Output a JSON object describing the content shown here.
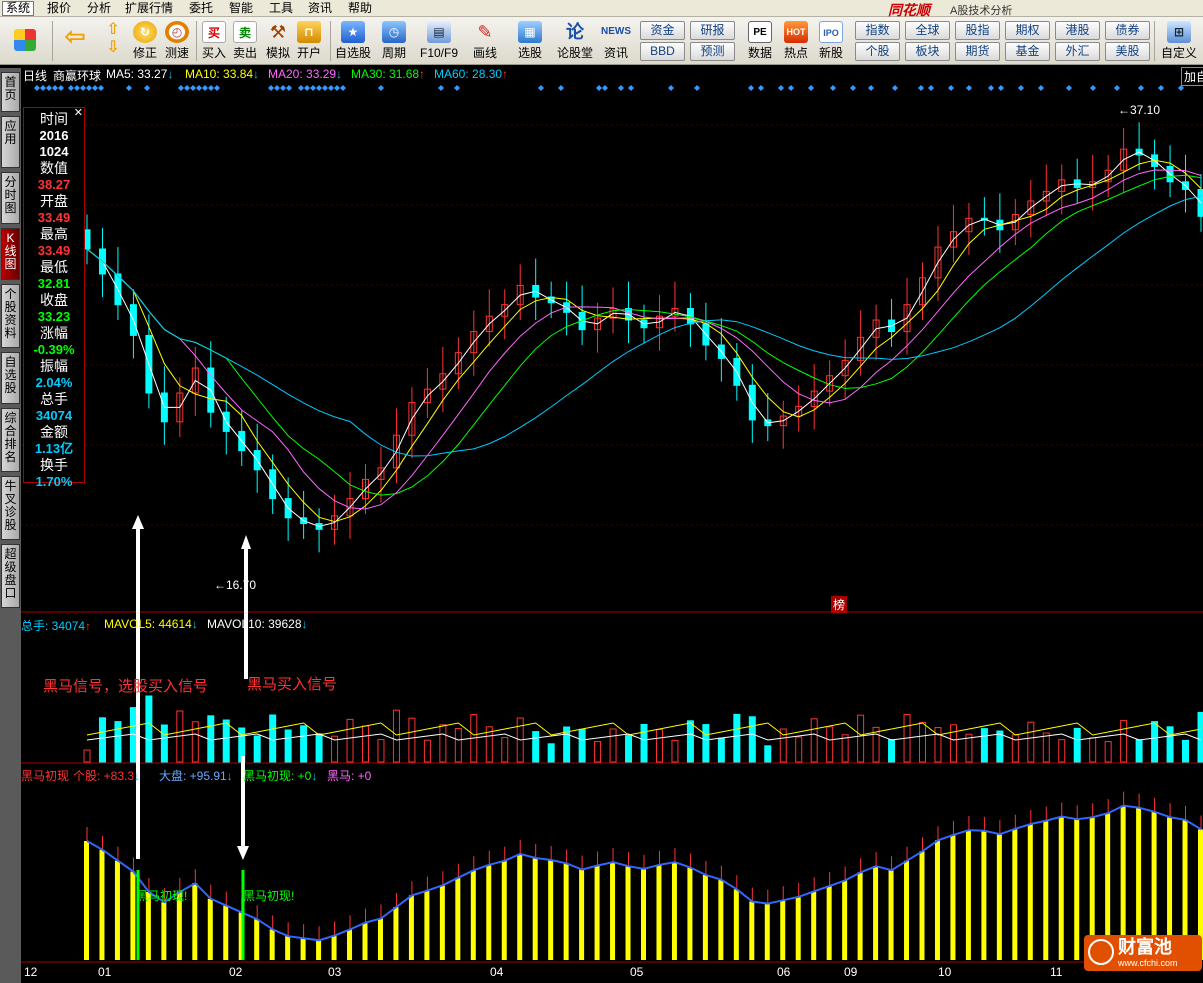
{
  "menu": [
    "系统",
    "报价",
    "分析",
    "扩展行情",
    "委托",
    "智能",
    "工具",
    "资讯",
    "帮助"
  ],
  "brand": "同花顺",
  "brand_sub": "A股技术分析",
  "toolbar": [
    {
      "label": "",
      "icon": "grid-icon"
    },
    {
      "label": "",
      "icon": "back-arrow-icon"
    },
    {
      "label": "",
      "icon": "up-down-icon"
    },
    {
      "label": "修正",
      "icon": "refresh-icon"
    },
    {
      "label": "测速",
      "icon": "clock-icon"
    },
    {
      "label": "买入",
      "glyph": "买"
    },
    {
      "label": "卖出",
      "glyph": "卖"
    },
    {
      "label": "模拟",
      "icon": "gavel-icon"
    },
    {
      "label": "开户",
      "icon": "lock-icon"
    },
    {
      "label": "自选股",
      "icon": "star-icon"
    },
    {
      "label": "周期",
      "icon": "cycle-icon"
    },
    {
      "label": "F10/F9",
      "icon": "document-icon"
    },
    {
      "label": "画线",
      "icon": "pencil-icon"
    },
    {
      "label": "选股",
      "icon": "select-icon"
    },
    {
      "label": "论股堂",
      "glyph": "论"
    },
    {
      "label": "资讯",
      "glyph": "NEWS"
    },
    {
      "label": "数据",
      "glyph": "PE"
    },
    {
      "label": "热点",
      "glyph": "HOT"
    },
    {
      "label": "新股",
      "glyph": "IPO"
    },
    {
      "label": "自定义",
      "icon": "customize-icon"
    }
  ],
  "small_buttons": [
    [
      "资金",
      "BBD"
    ],
    [
      "研报",
      "预测"
    ],
    [
      "指数",
      "个股"
    ],
    [
      "全球",
      "板块"
    ],
    [
      "股指",
      "期货"
    ],
    [
      "期权",
      "基金"
    ],
    [
      "港股",
      "外汇"
    ],
    [
      "债券",
      "美股"
    ]
  ],
  "left_nav": [
    "首页",
    "应用",
    "分时图",
    "K线图",
    "个股资料",
    "自选股",
    "综合排名",
    "牛叉诊股",
    "超级盘口"
  ],
  "ma_line": {
    "period": "日线",
    "name": "商赢环球",
    "items": [
      {
        "label": "MA5: 33.27",
        "arrow": "↓",
        "color": "#ffffff",
        "arrow_color": "#00c8ff"
      },
      {
        "label": "MA10: 33.84",
        "arrow": "↓",
        "color": "#ffff00",
        "arrow_color": "#00c8ff"
      },
      {
        "label": "MA20: 33.29",
        "arrow": "↓",
        "color": "#ff66ff",
        "arrow_color": "#00c8ff"
      },
      {
        "label": "MA30: 31.68",
        "arrow": "↑",
        "color": "#00ff00",
        "arrow_color": "#ff3333"
      },
      {
        "label": "MA60: 28.30",
        "arrow": "↑",
        "color": "#00ccff",
        "arrow_color": "#ff3333"
      }
    ],
    "right": "加自"
  },
  "info": [
    {
      "k": "时间"
    },
    {
      "v": "2016",
      "c": "#ffffff"
    },
    {
      "v": "1024",
      "c": "#ffffff"
    },
    {
      "k": "数值"
    },
    {
      "v": "38.27",
      "c": "#ff3333"
    },
    {
      "k": "开盘"
    },
    {
      "v": "33.49",
      "c": "#ff3333"
    },
    {
      "k": "最高"
    },
    {
      "v": "33.49",
      "c": "#ff3333"
    },
    {
      "k": "最低"
    },
    {
      "v": "32.81",
      "c": "#00ff00"
    },
    {
      "k": "收盘"
    },
    {
      "v": "33.23",
      "c": "#00ff00"
    },
    {
      "k": "涨幅"
    },
    {
      "v": "-0.39%",
      "c": "#00ff00"
    },
    {
      "k": "振幅"
    },
    {
      "v": "2.04%",
      "c": "#00ccff"
    },
    {
      "k": "总手"
    },
    {
      "v": "34074",
      "c": "#00ccff"
    },
    {
      "k": "金额"
    },
    {
      "v": "1.13亿",
      "c": "#00ccff"
    },
    {
      "k": "换手"
    },
    {
      "v": "1.70%",
      "c": "#00ccff"
    }
  ],
  "price_marks": {
    "high": "37.10",
    "low": "16.70"
  },
  "volume_line": {
    "items": [
      {
        "label": "总手: 34074",
        "arrow": "↑",
        "color": "#00ccff"
      },
      {
        "label": "MAVOL5: 44614",
        "arrow": "↓",
        "color": "#ffff00"
      },
      {
        "label": "MAVOL10: 39628",
        "arrow": "↓",
        "color": "#ffffff"
      }
    ]
  },
  "rank_badge": "榜",
  "indicator_line": {
    "items": [
      {
        "label": "黑马初现",
        "color": "#ff3333"
      },
      {
        "label": "个股: +83.3",
        "arrow": "↓",
        "color": "#ff3333"
      },
      {
        "label": "大盘: +95.91",
        "arrow": "↓",
        "color": "#66aaff"
      },
      {
        "label": "黑马初现: +0",
        "arrow": "↓",
        "color": "#00ff00"
      },
      {
        "label": "黑马: +0",
        "color": "#ff66ff"
      }
    ]
  },
  "annotations": [
    {
      "text": "黑马信号，选股买入信号",
      "color": "#ff3333"
    },
    {
      "text": "黑马买入信号",
      "color": "#ff3333"
    },
    {
      "text": "黑马初现!",
      "color": "#00ff00"
    },
    {
      "text": "黑马初现!",
      "color": "#00ff00"
    }
  ],
  "x_axis": [
    "12",
    "01",
    "02",
    "03",
    "04",
    "05",
    "06",
    "09",
    "10",
    "11"
  ],
  "watermark": {
    "logo": "财富池",
    "url": "www.cfchi.com"
  },
  "colors": {
    "up": "#ff3333",
    "down": "#00ffff",
    "ma5": "#ffffff",
    "ma10": "#ffff00",
    "ma20": "#ff66ff",
    "ma30": "#00ff00",
    "ma60": "#00ccff",
    "grid": "#8b0000"
  },
  "chart_data": {
    "type": "candlestick",
    "title": "商赢环球 日线",
    "price_high": 37.1,
    "price_low": 16.7,
    "months": [
      "12",
      "01",
      "02",
      "03",
      "04",
      "05",
      "06",
      "09",
      "10",
      "11"
    ],
    "close_series": [
      31.5,
      30.2,
      28.6,
      27.0,
      24.0,
      22.5,
      24.0,
      25.3,
      23.0,
      22.0,
      21.0,
      20.0,
      18.5,
      17.5,
      17.2,
      16.9,
      17.6,
      18.5,
      19.5,
      20.1,
      21.8,
      23.5,
      24.2,
      25.0,
      26.1,
      27.2,
      28.0,
      28.6,
      29.6,
      29.0,
      28.7,
      28.2,
      27.3,
      27.9,
      28.4,
      27.8,
      27.4,
      28.0,
      28.4,
      27.6,
      26.5,
      25.8,
      24.4,
      22.6,
      22.3,
      22.8,
      23.3,
      24.1,
      24.9,
      25.7,
      26.9,
      27.8,
      27.2,
      28.6,
      30.0,
      31.6,
      32.4,
      33.1,
      33.0,
      32.5,
      33.3,
      34.0,
      34.5,
      35.1,
      34.7,
      35.0,
      35.6,
      36.7,
      36.4,
      35.8,
      35.0,
      34.6,
      33.2
    ]
  }
}
